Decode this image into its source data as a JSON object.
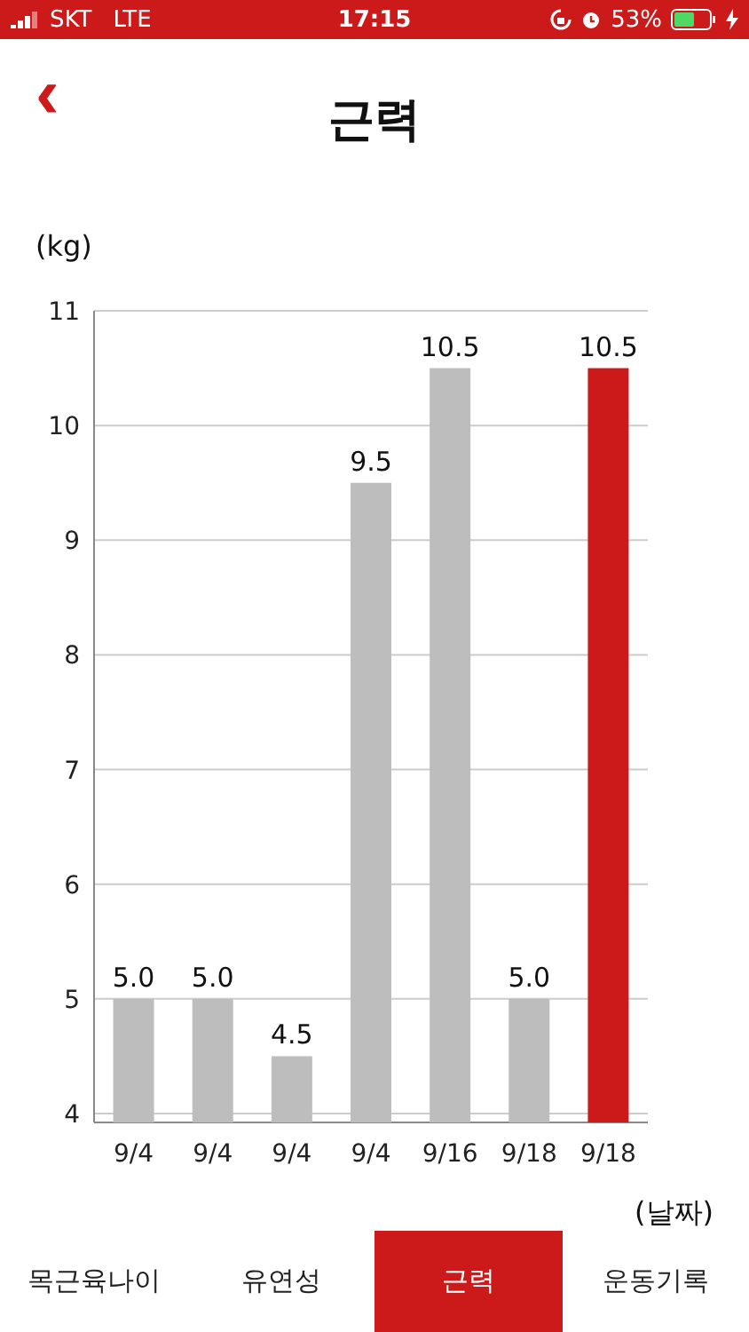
{
  "status_bar": {
    "carrier": "SKT",
    "network": "LTE",
    "time": "17:15",
    "battery": "53%"
  },
  "header": {
    "back": "‹",
    "title": "근력"
  },
  "chart": {
    "chart_data": {
      "type": "bar",
      "xlabel": "(날짜)",
      "ylabel": "(kg)",
      "categories": [
        "9/4",
        "9/4",
        "9/4",
        "9/4",
        "9/16",
        "9/18",
        "9/18"
      ],
      "stacked": true,
      "grid": true,
      "ylim": [
        4,
        11
      ],
      "yticks": [
        4,
        5,
        6,
        7,
        8,
        9,
        10,
        11
      ],
      "series": [
        {
          "color": "#bdbdbd",
          "values": [
            5.0,
            5.0,
            4.5,
            9.5,
            10.5,
            5.0,
            null
          ]
        },
        {
          "color": "#cc1a1a",
          "values": [
            null,
            null,
            null,
            null,
            null,
            null,
            10.5
          ]
        }
      ],
      "value_labels": [
        "5.0",
        "5.0",
        "4.5",
        "9.5",
        "10.5",
        "5.0",
        "10.5"
      ]
    }
  },
  "tabs": [
    {
      "label": "목근육나이",
      "selected": false
    },
    {
      "label": "유연성",
      "selected": false
    },
    {
      "label": "근력",
      "selected": true
    },
    {
      "label": "운동기록",
      "selected": false
    }
  ]
}
